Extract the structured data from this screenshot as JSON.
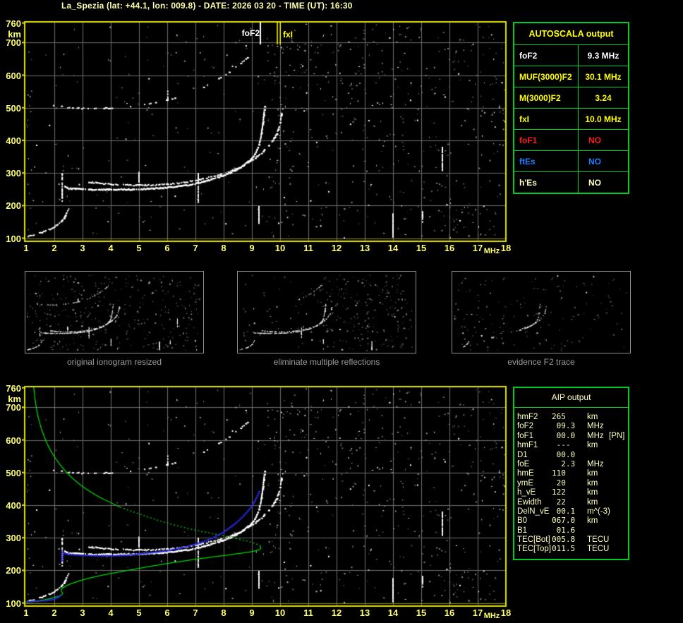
{
  "title": "La_Spezia (lat: +44.1, lon: 009.8) - DATE: 2026 03 20 - TIME (UT): 16:30",
  "colors": {
    "background": "#000000",
    "plot_border": "#e3e300",
    "axis_label": "#ffff70",
    "grid": "#6e6e6e",
    "table_border": "#00cc22",
    "title_text": "#ffffb0",
    "caption_text": "#9c9c9c",
    "green_profile": "#00d400",
    "blue_trace": "#2a2ae8",
    "foF2_marker": "#ffffff",
    "fxI_marker": "#ffff00"
  },
  "autoscala": {
    "title": "AUTOSCALA output",
    "rows": [
      {
        "label": "foF2",
        "value": "9.3 MHz",
        "color": "#ffffff",
        "value_align": "center"
      },
      {
        "label": "MUF(3000)F2",
        "value": "30.1 MHz",
        "color": "#ffff00",
        "value_align": "center"
      },
      {
        "label": "M(3000)F2",
        "value": "3.24",
        "color": "#ffff00",
        "value_align": "center"
      },
      {
        "label": "fxI",
        "value": "10.0 MHz",
        "color": "#ffff00",
        "value_align": "center"
      },
      {
        "label": "foF1",
        "value": "NO",
        "color": "#ff1a1a",
        "value_align": "left"
      },
      {
        "label": "ftEs",
        "value": "NO",
        "color": "#1f7bff",
        "value_align": "left"
      },
      {
        "label": "h'Es",
        "value": "NO",
        "color": "#ffffc0",
        "value_align": "left"
      }
    ]
  },
  "aip": {
    "title": "AIP output",
    "rows": [
      {
        "label": "hmF2",
        "value": "265",
        "unit": "km",
        "note": ""
      },
      {
        "label": "foF2",
        "value": " 09.3",
        "unit": "MHz",
        "note": ""
      },
      {
        "label": "foF1",
        "value": " 00.0",
        "unit": "MHz",
        "note": "[PN]"
      },
      {
        "label": "hmF1",
        "value": " ---",
        "unit": "km",
        "note": ""
      },
      {
        "label": "D1",
        "value": " 00.0",
        "unit": "",
        "note": ""
      },
      {
        "label": "foE",
        "value": "  2.3",
        "unit": "MHz",
        "note": ""
      },
      {
        "label": "hmE",
        "value": "110",
        "unit": "km",
        "note": ""
      },
      {
        "label": "ymE",
        "value": " 20",
        "unit": "km",
        "note": ""
      },
      {
        "label": "h_vE",
        "value": "122",
        "unit": "km",
        "note": ""
      },
      {
        "label": "Ewidth",
        "value": " 22",
        "unit": "km",
        "note": ""
      },
      {
        "label": "DelN_vE",
        "value": " 00.1",
        "unit": "m^(-3)",
        "note": ""
      },
      {
        "label": "B0",
        "value": "067.0",
        "unit": "km",
        "note": ""
      },
      {
        "label": "B1",
        "value": " 01.6",
        "unit": "",
        "note": ""
      },
      {
        "label": "TEC[Bot]",
        "value": "005.8",
        "unit": "TECU",
        "note": ""
      },
      {
        "label": "TEC[Top]",
        "value": "011.5",
        "unit": "TECU",
        "note": ""
      }
    ]
  },
  "thumbnails": [
    {
      "caption": "original ionogram resized"
    },
    {
      "caption": "eliminate multiple reflections"
    },
    {
      "caption": "evidence F2 trace"
    }
  ],
  "axes": {
    "x_ticks": [
      "1",
      "2",
      "3",
      "4",
      "5",
      "6",
      "7",
      "8",
      "9",
      "10",
      "11",
      "12",
      "13",
      "14",
      "15",
      "16",
      "17",
      "18"
    ],
    "x_unit": "MHz",
    "y_ticks": [
      "760",
      "700",
      "600",
      "500",
      "400",
      "300",
      "200",
      "100"
    ],
    "y_unit": "km",
    "x_range": [
      1,
      18
    ],
    "y_range": [
      100,
      760
    ]
  },
  "markers": {
    "foF2": {
      "label": "foF2",
      "freq": 9.3
    },
    "fxI": {
      "label": "fxI",
      "freq": 9.95
    }
  },
  "chart_data": {
    "type": "scatter",
    "title": "Ionogram - virtual height (km) vs sounding frequency (MHz)",
    "xlabel": "MHz",
    "ylabel": "km",
    "xlim": [
      1,
      18
    ],
    "ylim": [
      100,
      760
    ],
    "grid": true,
    "traces": {
      "e_trace": [
        [
          1.05,
          106
        ],
        [
          1.3,
          112
        ],
        [
          1.6,
          120
        ],
        [
          1.9,
          130
        ],
        [
          2.1,
          142
        ],
        [
          2.3,
          158
        ],
        [
          2.4,
          175
        ],
        [
          2.5,
          192
        ]
      ],
      "o_trace": [
        [
          2.35,
          258
        ],
        [
          2.45,
          252
        ],
        [
          2.7,
          252
        ],
        [
          3.0,
          250
        ],
        [
          3.5,
          249
        ],
        [
          4.0,
          249
        ],
        [
          4.5,
          249
        ],
        [
          5.0,
          250
        ],
        [
          5.5,
          252
        ],
        [
          6.0,
          255
        ],
        [
          6.5,
          260
        ],
        [
          7.0,
          267
        ],
        [
          7.4,
          276
        ],
        [
          7.8,
          287
        ],
        [
          8.2,
          300
        ],
        [
          8.6,
          318
        ],
        [
          8.9,
          338
        ],
        [
          9.1,
          358
        ],
        [
          9.22,
          382
        ],
        [
          9.3,
          412
        ],
        [
          9.36,
          448
        ],
        [
          9.4,
          478
        ],
        [
          9.43,
          502
        ]
      ],
      "x_trace": [
        [
          3.2,
          272
        ],
        [
          3.6,
          268
        ],
        [
          4.0,
          265
        ],
        [
          4.5,
          263
        ],
        [
          5.0,
          262
        ],
        [
          5.6,
          263
        ],
        [
          6.1,
          266
        ],
        [
          6.6,
          271
        ],
        [
          7.1,
          279
        ],
        [
          7.6,
          289
        ],
        [
          8.1,
          302
        ],
        [
          8.6,
          319
        ],
        [
          9.0,
          340
        ],
        [
          9.35,
          363
        ],
        [
          9.65,
          390
        ],
        [
          9.85,
          418
        ],
        [
          9.97,
          450
        ],
        [
          10.03,
          482
        ]
      ],
      "second_hop_flat": [
        [
          1.95,
          506
        ],
        [
          2.4,
          501
        ],
        [
          2.9,
          498
        ],
        [
          3.4,
          497
        ],
        [
          3.9,
          499
        ],
        [
          4.4,
          502
        ],
        [
          4.9,
          507
        ],
        [
          5.4,
          513
        ],
        [
          5.9,
          522
        ],
        [
          6.3,
          531
        ]
      ],
      "second_hop_rise": [
        [
          6.8,
          545
        ],
        [
          7.2,
          560
        ],
        [
          7.6,
          578
        ],
        [
          8.0,
          598
        ],
        [
          8.35,
          620
        ],
        [
          8.7,
          645
        ],
        [
          9.0,
          668
        ],
        [
          9.15,
          685
        ],
        [
          9.25,
          700
        ]
      ]
    },
    "interference_strips": [
      {
        "freq": 2.28,
        "km_from": 216,
        "km_to": 300,
        "density": 0.55
      },
      {
        "freq": 5.0,
        "km_from": 266,
        "km_to": 306,
        "density": 0.7
      },
      {
        "freq": 6.02,
        "km_from": 526,
        "km_to": 562,
        "density": 0.5
      },
      {
        "freq": 7.1,
        "km_from": 210,
        "km_to": 302,
        "density": 0.55
      },
      {
        "freq": 9.25,
        "km_from": 148,
        "km_to": 200,
        "density": 0.7
      },
      {
        "freq": 14.0,
        "km_from": 106,
        "km_to": 178,
        "density": 0.8
      },
      {
        "freq": 15.05,
        "km_from": 152,
        "km_to": 186,
        "density": 0.6
      },
      {
        "freq": 15.75,
        "km_from": 310,
        "km_to": 382,
        "density": 0.7
      }
    ],
    "green_profile": {
      "topside": [
        [
          1.27,
          762
        ],
        [
          1.33,
          706
        ],
        [
          1.53,
          632
        ],
        [
          1.88,
          561
        ],
        [
          2.5,
          490
        ],
        [
          3.33,
          435
        ],
        [
          4.33,
          394
        ],
        [
          5.4,
          360
        ],
        [
          6.65,
          329
        ],
        [
          7.9,
          308
        ],
        [
          8.75,
          292
        ],
        [
          9.15,
          282
        ],
        [
          9.3,
          274
        ]
      ],
      "bottomside": [
        [
          9.3,
          274
        ],
        [
          9.33,
          268
        ],
        [
          9.25,
          262
        ],
        [
          8.9,
          256
        ],
        [
          8.33,
          249
        ],
        [
          7.5,
          240
        ],
        [
          6.6,
          229
        ],
        [
          5.83,
          219
        ],
        [
          5.0,
          206
        ],
        [
          4.15,
          193
        ],
        [
          3.5,
          182
        ],
        [
          2.9,
          168
        ],
        [
          2.5,
          156
        ],
        [
          2.3,
          147
        ],
        [
          2.22,
          140
        ],
        [
          2.28,
          133
        ],
        [
          2.3,
          127
        ],
        [
          2.2,
          122
        ],
        [
          2.05,
          118
        ],
        [
          1.8,
          112
        ],
        [
          1.5,
          107
        ],
        [
          1.2,
          104
        ],
        [
          1.0,
          102
        ]
      ]
    },
    "blue_trace": {
      "e_part": [
        [
          1.0,
          104
        ],
        [
          1.25,
          105
        ],
        [
          1.5,
          106
        ],
        [
          1.75,
          108
        ],
        [
          1.95,
          111
        ],
        [
          2.1,
          116
        ],
        [
          2.2,
          122
        ]
      ],
      "f_part": [
        [
          2.27,
          230
        ],
        [
          2.27,
          256
        ],
        [
          2.4,
          251
        ],
        [
          2.7,
          248
        ],
        [
          3.1,
          246
        ],
        [
          3.6,
          245
        ],
        [
          4.1,
          245
        ],
        [
          4.6,
          247
        ],
        [
          5.1,
          251
        ],
        [
          5.6,
          256
        ],
        [
          6.1,
          262
        ],
        [
          6.6,
          271
        ],
        [
          7.1,
          283
        ],
        [
          7.6,
          299
        ],
        [
          8.0,
          318
        ],
        [
          8.4,
          343
        ],
        [
          8.7,
          367
        ],
        [
          8.95,
          392
        ],
        [
          9.1,
          413
        ],
        [
          9.2,
          430
        ],
        [
          9.26,
          442
        ]
      ]
    },
    "noise": {
      "seed": 1234,
      "uniform": 270,
      "right_half": 250,
      "near_fxI_column": 55,
      "top_right": 50,
      "bottom_right_cluster": 30,
      "left_edge": 15
    }
  }
}
